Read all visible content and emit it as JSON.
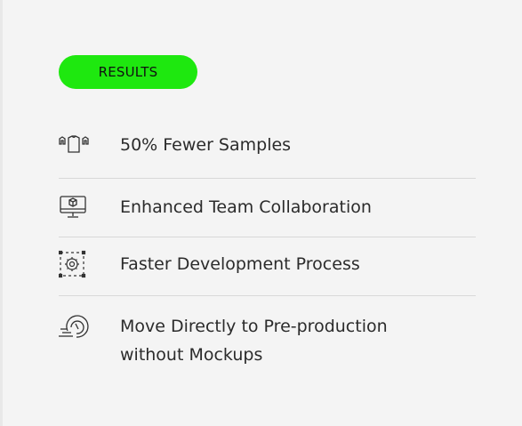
{
  "badge": {
    "label": "RESULTS",
    "color": "#1ee80f"
  },
  "results": [
    {
      "icon": "garment-samples-icon",
      "label": "50% Fewer Samples"
    },
    {
      "icon": "monitor-3d-icon",
      "label": "Enhanced Team Collaboration"
    },
    {
      "icon": "gear-process-icon",
      "label": "Faster Development Process"
    },
    {
      "icon": "speedometer-icon",
      "label": "Move Directly to Pre-production without Mockups"
    }
  ]
}
